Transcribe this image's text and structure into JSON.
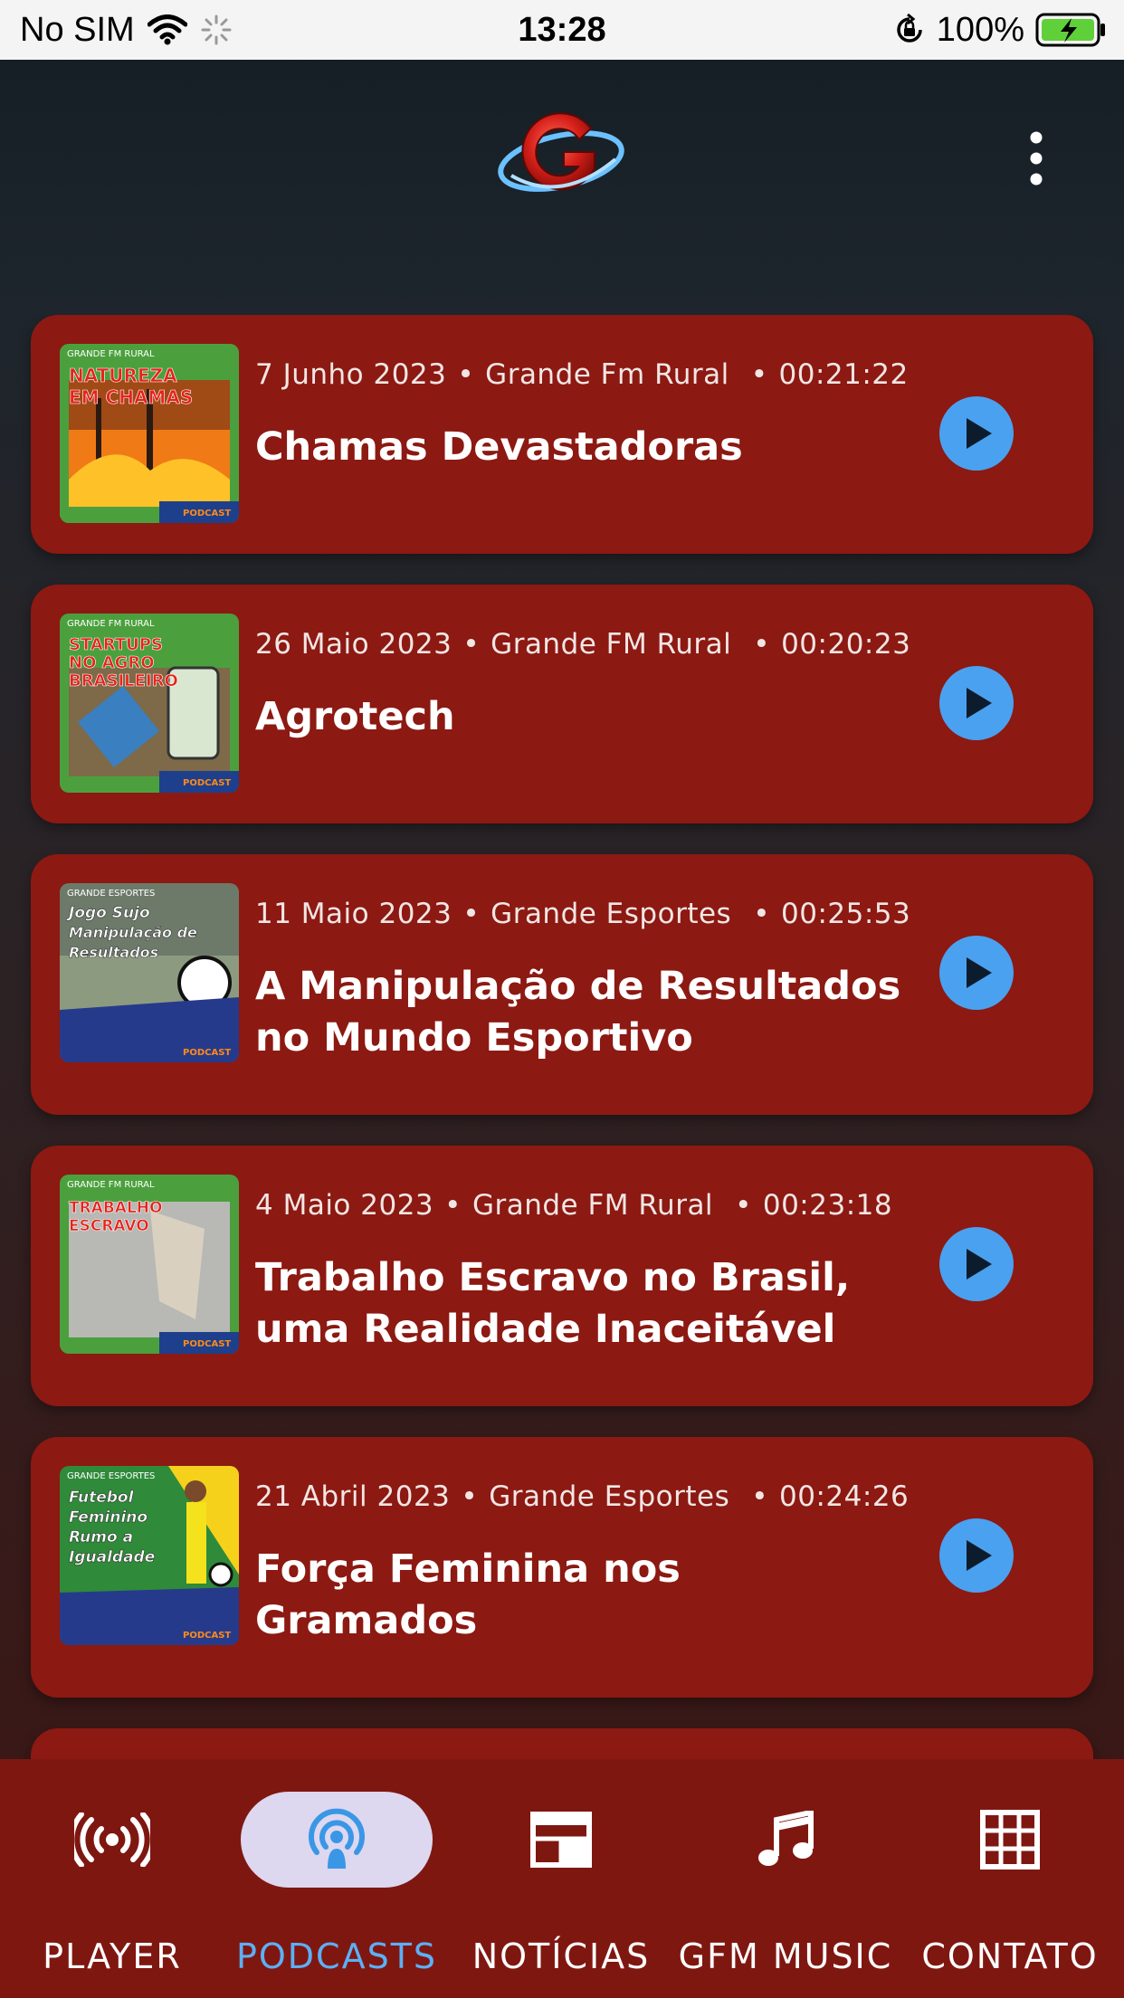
{
  "status_bar": {
    "carrier": "No SIM",
    "time": "13:28",
    "battery": "100%"
  },
  "header": {
    "logo_icon": "grande-fm-logo",
    "menu_icon": "more-vertical-icon"
  },
  "podcasts": [
    {
      "date": "7 Junho 2023",
      "program": "Grande Fm Rural",
      "duration": "00:21:22",
      "title": "Chamas Devastadoras",
      "cover_tag": "GRANDE FM RURAL",
      "cover_text": "NATUREZA EM CHAMAS",
      "cover_badge": "PODCAST"
    },
    {
      "date": "26 Maio 2023",
      "program": "Grande FM Rural",
      "duration": "00:20:23",
      "title": "Agrotech",
      "cover_tag": "GRANDE FM RURAL",
      "cover_text": "STARTUPS NO AGRO BRASILEIRO",
      "cover_badge": "PODCAST"
    },
    {
      "date": "11 Maio 2023",
      "program": "Grande Esportes",
      "duration": "00:25:53",
      "title": "A Manipulação de Resultados no Mundo Esportivo",
      "cover_tag": "GRANDE ESPORTES",
      "cover_text": "Jogo Sujo Manipulação de Resultados",
      "cover_badge": "PODCAST"
    },
    {
      "date": "4 Maio 2023",
      "program": "Grande FM Rural",
      "duration": "00:23:18",
      "title": "Trabalho Escravo no Brasil, uma Realidade Inaceitável",
      "cover_tag": "GRANDE FM RURAL",
      "cover_text": "TRABALHO ESCRAVO",
      "cover_badge": "PODCAST"
    },
    {
      "date": "21 Abril 2023",
      "program": "Grande Esportes",
      "duration": "00:24:26",
      "title": "Força Feminina nos Gramados",
      "cover_tag": "GRANDE ESPORTES",
      "cover_text": "Futebol Feminino Rumo a Igualdade",
      "cover_badge": "PODCAST"
    }
  ],
  "separator": "•",
  "bottom_nav": [
    {
      "label": "PLAYER",
      "icon": "radio-broadcast-icon",
      "active": false
    },
    {
      "label": "PODCASTS",
      "icon": "podcast-icon",
      "active": true
    },
    {
      "label": "NOTÍCIAS",
      "icon": "newspaper-icon",
      "active": false
    },
    {
      "label": "GFM MUSIC",
      "icon": "music-note-icon",
      "active": false
    },
    {
      "label": "CONTATO",
      "icon": "grid-icon",
      "active": false
    }
  ],
  "colors": {
    "card": "#8c1912",
    "nav_bg": "#7f1711",
    "play_button": "#4aa1f0",
    "active_label": "#5cb0f5",
    "active_pill": "#ddd7f0",
    "battery": "#5fd03a"
  }
}
